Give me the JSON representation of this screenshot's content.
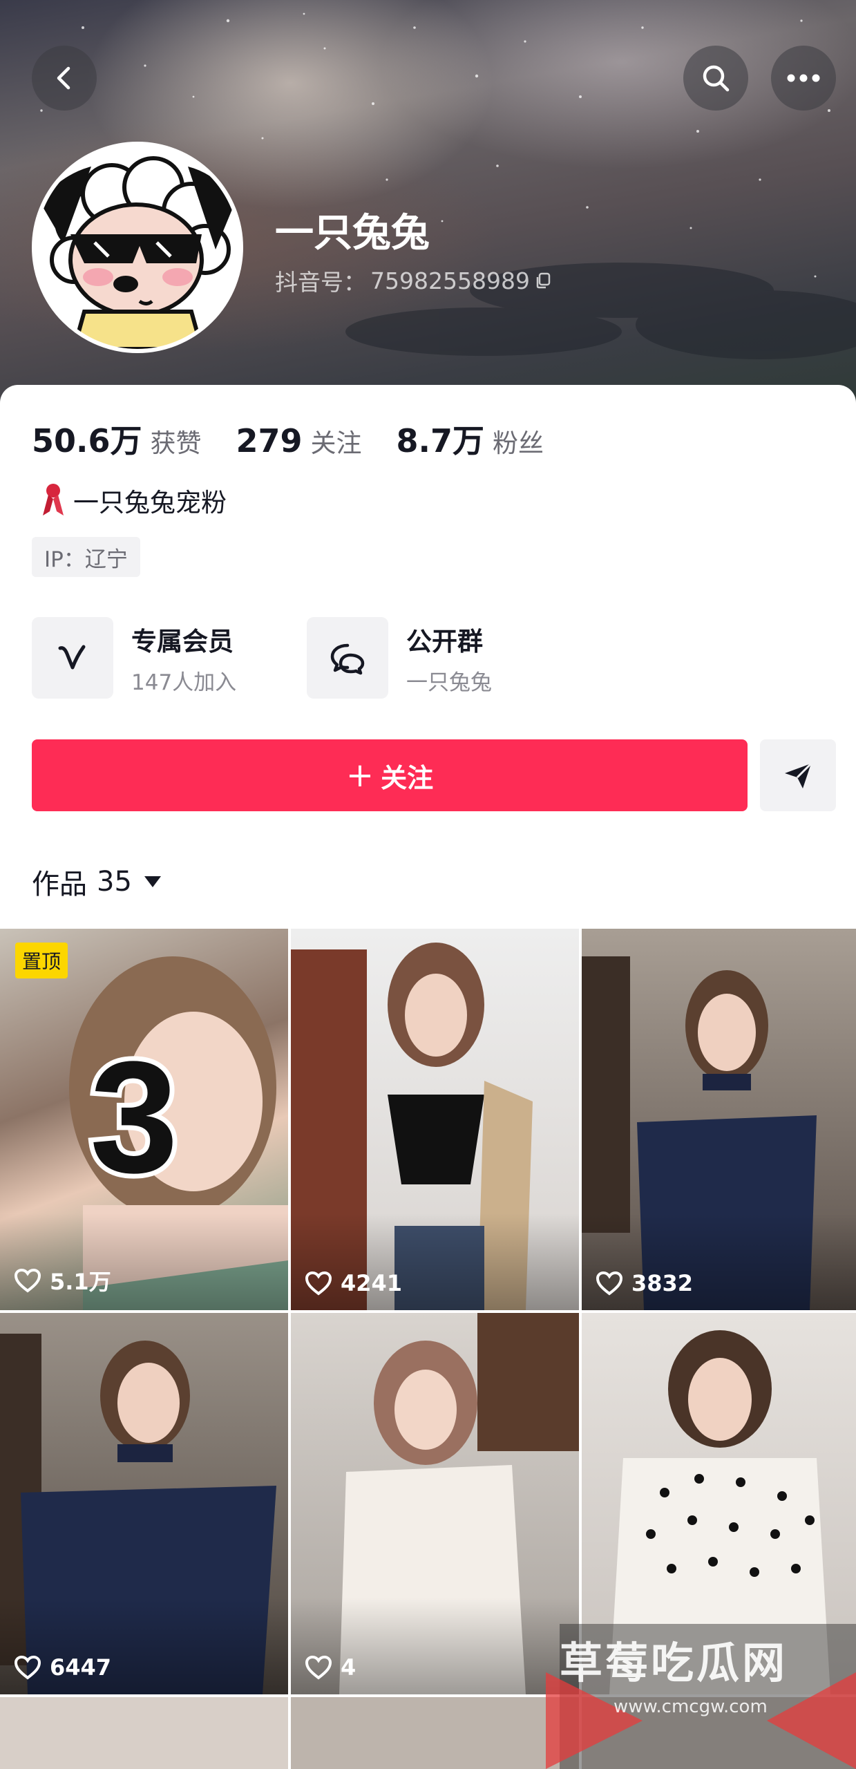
{
  "header": {
    "nickname": "一只兔兔",
    "douyin_id_label": "抖音号：",
    "douyin_id": "75982558989"
  },
  "stats": [
    {
      "value": "50.6万",
      "label": "获赞"
    },
    {
      "value": "279",
      "label": "关注"
    },
    {
      "value": "8.7万",
      "label": "粉丝"
    }
  ],
  "fan_group": "一只兔兔宠粉",
  "ip": "IP：辽宁",
  "features": [
    {
      "title": "专属会员",
      "subtitle": "147人加入",
      "icon": "v-member-icon"
    },
    {
      "title": "公开群",
      "subtitle": "一只兔兔",
      "icon": "group-chat-icon"
    }
  ],
  "follow_button": {
    "plus": "+",
    "label": "关注"
  },
  "works_tab": {
    "label": "作品",
    "count": "35"
  },
  "videos": [
    {
      "likes": "5.1万",
      "pinned_label": "置顶",
      "overlay_text": "3"
    },
    {
      "likes": "4241"
    },
    {
      "likes": "3832"
    },
    {
      "likes": "6447"
    },
    {
      "likes": "4"
    },
    {
      "likes": ""
    }
  ],
  "watermark": {
    "title": "草莓吃瓜网",
    "url": "www.cmcgw.com"
  },
  "colors": {
    "accent": "#fe2c55",
    "pin": "#fcd600",
    "text": "#161823",
    "muted": "#6b6b73"
  }
}
